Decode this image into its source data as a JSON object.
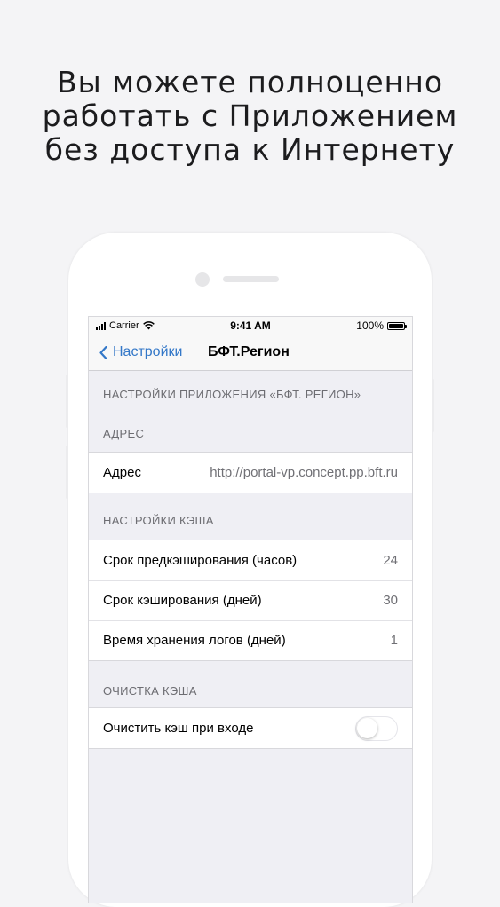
{
  "headline": {
    "line1": "Вы можете полноценно",
    "line2": "работать с Приложением",
    "line3": "без доступа к Интернету"
  },
  "status_bar": {
    "carrier": "Carrier",
    "time": "9:41 AM",
    "battery": "100%"
  },
  "nav": {
    "back_label": "Настройки",
    "title": "БФТ.Регион"
  },
  "settings": {
    "app_header": "НАСТРОЙКИ ПРИЛОЖЕНИЯ «БФТ. РЕГИОН»",
    "address_header": "АДРЕС",
    "address_label": "Адрес",
    "address_value": "http://portal-vp.concept.pp.bft.ru",
    "cache_header": "НАСТРОЙКИ КЭША",
    "cache_rows": [
      {
        "label": "Срок предкэширования (часов)",
        "value": "24"
      },
      {
        "label": "Срок кэширования (дней)",
        "value": "30"
      },
      {
        "label": "Время хранения логов (дней)",
        "value": "1"
      }
    ],
    "clear_header": "ОЧИСТКА КЭША",
    "clear_label": "Очистить кэш при входе",
    "clear_toggle_on": false
  },
  "colors": {
    "accent": "#3478c8",
    "background": "#f4f4f6",
    "list_background": "#efeff4"
  }
}
